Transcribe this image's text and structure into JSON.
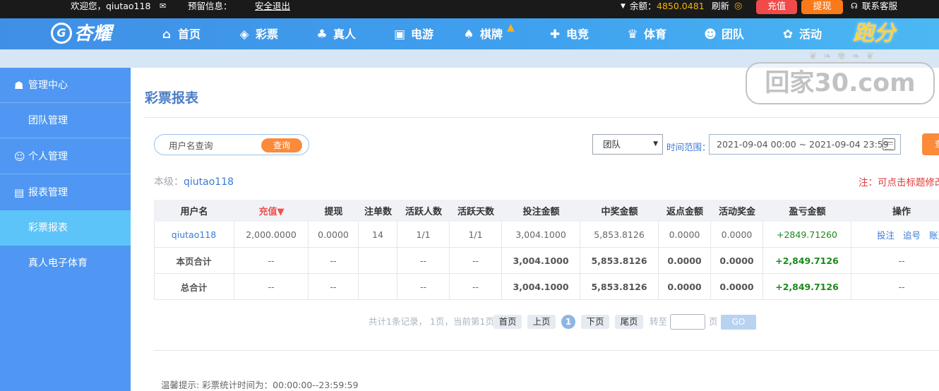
{
  "topbar": {
    "welcome": "欢迎您，qiutao118",
    "notice_label": "预留信息：",
    "logout": "安全退出",
    "balance_label": "余额：",
    "balance_value": "4850.0481",
    "refresh": "刷新",
    "recharge": "充值",
    "withdraw": "提现",
    "service": "联系客服"
  },
  "nav": {
    "logo_mark": "G",
    "logo_text": "杏耀",
    "items": [
      {
        "label": "首页",
        "icon": "home-icon"
      },
      {
        "label": "彩票",
        "icon": "ticket-icon"
      },
      {
        "label": "真人",
        "icon": "live-dealer-icon"
      },
      {
        "label": "电游",
        "icon": "slot-machine-icon"
      },
      {
        "label": "棋牌",
        "icon": "cards-icon"
      },
      {
        "label": "电竞",
        "icon": "gamepad-icon"
      },
      {
        "label": "体育",
        "icon": "trophy-icon"
      },
      {
        "label": "团队",
        "icon": "team-icon"
      },
      {
        "label": "活动",
        "icon": "gift-icon"
      }
    ],
    "special": "跑分"
  },
  "sidebar": {
    "items": [
      {
        "label": "管理中心",
        "type": "head",
        "icon": "users-icon"
      },
      {
        "label": "团队管理",
        "type": "sub"
      },
      {
        "label": "个人管理",
        "type": "head",
        "icon": "user-icon"
      },
      {
        "label": "报表管理",
        "type": "head",
        "icon": "report-icon"
      },
      {
        "label": "彩票报表",
        "type": "sub",
        "active": true
      },
      {
        "label": "真人电子体育",
        "type": "sub"
      }
    ]
  },
  "page": {
    "title": "彩票报表",
    "search_placeholder": "用户名查询",
    "search_button": "查询",
    "scope_select": "团队",
    "time_label": "时间范围：",
    "date_range": "2021-09-04 00:00 ~ 2021-09-04 23:59",
    "query_button": "查",
    "level_label": "本级：",
    "level_user": "qiutao118",
    "note": "注：可点击标题修改"
  },
  "table": {
    "headers": [
      "用户名",
      "充值▼",
      "提现",
      "注单数",
      "活跃人数",
      "活跃天数",
      "投注金额",
      "中奖金额",
      "返点金额",
      "活动奖金",
      "盈亏金额",
      "操作"
    ],
    "rows": [
      {
        "user": "qiutao118",
        "recharge": "2,000.0000",
        "withdraw": "0.0000",
        "orders": "14",
        "active_users": "1/1",
        "active_days": "1/1",
        "bet": "3,004.1000",
        "win": "5,853.8126",
        "rebate": "0.0000",
        "bonus": "0.0000",
        "profit": "+2849.71260",
        "ops": [
          "投注",
          "追号",
          "账变"
        ]
      },
      {
        "user": "本页合计",
        "recharge": "--",
        "withdraw": "--",
        "orders": "",
        "active_users": "--",
        "active_days": "--",
        "bet": "3,004.1000",
        "win": "5,853.8126",
        "rebate": "0.0000",
        "bonus": "0.0000",
        "profit": "+2,849.7126",
        "ops_text": "--"
      },
      {
        "user": "总合计",
        "recharge": "--",
        "withdraw": "--",
        "orders": "",
        "active_users": "--",
        "active_days": "--",
        "bet": "3,004.1000",
        "win": "5,853.8126",
        "rebate": "0.0000",
        "bonus": "0.0000",
        "profit": "+2,849.7126",
        "ops_text": "--"
      }
    ]
  },
  "pagination": {
    "info": "共计1条记录， 1页，当前第1页",
    "first": "首页",
    "prev": "上页",
    "current": "1",
    "next": "下页",
    "last": "尾页",
    "goto_label": "转至",
    "page_unit": "页",
    "go": "GO"
  },
  "footer": {
    "tip": "温馨提示: 彩票统计时间为：00:00:00--23:59:59"
  },
  "watermark": {
    "text": "回家30.com"
  }
}
